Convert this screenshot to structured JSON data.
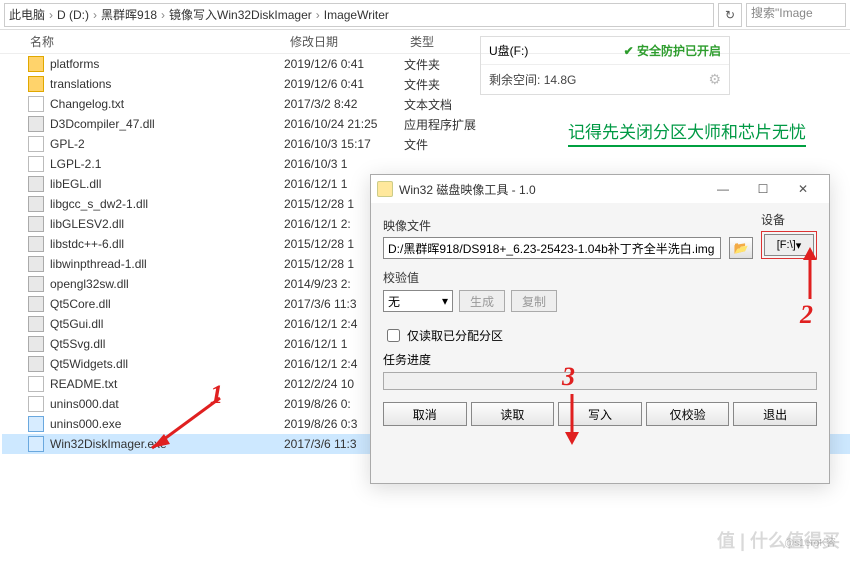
{
  "breadcrumb": {
    "parts": [
      "此电脑",
      "D (D:)",
      "黑群晖918",
      "镜像写入Win32DiskImager",
      "ImageWriter"
    ]
  },
  "search": {
    "placeholder": "搜索\"Image"
  },
  "columns": {
    "name": "名称",
    "date": "修改日期",
    "type": "类型"
  },
  "files": [
    {
      "ico": "folder",
      "name": "platforms",
      "date": "2019/12/6 0:41",
      "type": "文件夹"
    },
    {
      "ico": "folder",
      "name": "translations",
      "date": "2019/12/6 0:41",
      "type": "文件夹"
    },
    {
      "ico": "txt",
      "name": "Changelog.txt",
      "date": "2017/3/2 8:42",
      "type": "文本文档"
    },
    {
      "ico": "dll",
      "name": "D3Dcompiler_47.dll",
      "date": "2016/10/24 21:25",
      "type": "应用程序扩展"
    },
    {
      "ico": "txt",
      "name": "GPL-2",
      "date": "2016/10/3 15:17",
      "type": "文件"
    },
    {
      "ico": "txt",
      "name": "LGPL-2.1",
      "date": "2016/10/3 1",
      "type": ""
    },
    {
      "ico": "dll",
      "name": "libEGL.dll",
      "date": "2016/12/1 1",
      "type": ""
    },
    {
      "ico": "dll",
      "name": "libgcc_s_dw2-1.dll",
      "date": "2015/12/28 1",
      "type": ""
    },
    {
      "ico": "dll",
      "name": "libGLESV2.dll",
      "date": "2016/12/1 2:",
      "type": ""
    },
    {
      "ico": "dll",
      "name": "libstdc++-6.dll",
      "date": "2015/12/28 1",
      "type": ""
    },
    {
      "ico": "dll",
      "name": "libwinpthread-1.dll",
      "date": "2015/12/28 1",
      "type": ""
    },
    {
      "ico": "dll",
      "name": "opengl32sw.dll",
      "date": "2014/9/23 2:",
      "type": ""
    },
    {
      "ico": "dll",
      "name": "Qt5Core.dll",
      "date": "2017/3/6 11:3",
      "type": ""
    },
    {
      "ico": "dll",
      "name": "Qt5Gui.dll",
      "date": "2016/12/1 2:4",
      "type": ""
    },
    {
      "ico": "dll",
      "name": "Qt5Svg.dll",
      "date": "2016/12/1 1",
      "type": ""
    },
    {
      "ico": "dll",
      "name": "Qt5Widgets.dll",
      "date": "2016/12/1 2:4",
      "type": ""
    },
    {
      "ico": "txt",
      "name": "README.txt",
      "date": "2012/2/24 10",
      "type": ""
    },
    {
      "ico": "txt",
      "name": "unins000.dat",
      "date": "2019/8/26 0:",
      "type": ""
    },
    {
      "ico": "exe",
      "name": "unins000.exe",
      "date": "2019/8/26 0:3",
      "type": ""
    },
    {
      "ico": "exe",
      "name": "Win32DiskImager.exe",
      "date": "2017/3/6 11:3",
      "type": "",
      "selected": true
    }
  ],
  "info": {
    "drive": "U盘(F:)",
    "shield": "安全防护已开启",
    "free_label": "剩余空间:",
    "free_value": "14.8G"
  },
  "annotation": "记得先关闭分区大师和芯片无忧",
  "dialog": {
    "title": "Win32 磁盘映像工具 - 1.0",
    "image_label": "映像文件",
    "image_path": "D:/黑群晖918/DS918+_6.23-25423-1.04b补丁齐全半洗白.img",
    "device_label": "设备",
    "device_value": "[F:\\]",
    "hash_label": "校验值",
    "hash_mode": "无",
    "hash_gen": "生成",
    "hash_copy": "复制",
    "read_only": "仅读取已分配分区",
    "progress": "任务进度",
    "btn_cancel": "取消",
    "btn_read": "读取",
    "btn_write": "写入",
    "btn_verify": "仅校验",
    "btn_exit": "退出"
  },
  "markers": {
    "m1": "1",
    "m2": "2",
    "m3": "3"
  },
  "watermark": {
    "main": "值 | 什么值得买",
    "sub": "@s1eroK容"
  }
}
